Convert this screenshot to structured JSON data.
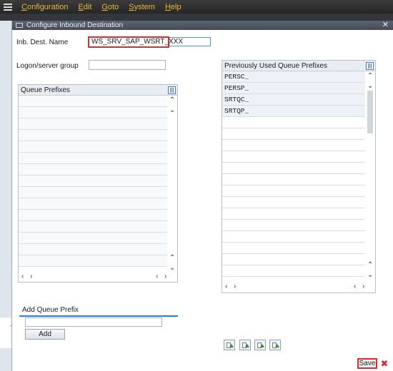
{
  "menubar": {
    "items": [
      {
        "underline": "C",
        "rest": "onfiguration"
      },
      {
        "underline": "E",
        "rest": "dit"
      },
      {
        "underline": "G",
        "rest": "oto"
      },
      {
        "underline": "S",
        "rest": "ystem"
      },
      {
        "underline": "H",
        "rest": "elp"
      }
    ]
  },
  "dialog": {
    "title": "Configure Inbound Destination",
    "close_glyph": "✕"
  },
  "form": {
    "inb_dest_label": "Inb. Dest. Name",
    "inb_dest_value": "WS_SRV_SAP_WSRT_XXX",
    "logon_label": "Logon/server group",
    "logon_value": ""
  },
  "queue_prefixes_table": {
    "header": "Queue Prefixes",
    "rows": []
  },
  "previous_prefixes_table": {
    "header": "Previously Used Queue Prefixes",
    "rows": [
      "PERSC_",
      "PERSP_",
      "SRTQC_",
      "SRTQP_"
    ]
  },
  "add_panel": {
    "title": "Add Queue Prefix",
    "input_value": "",
    "add_label": "Add"
  },
  "footer": {
    "save_label": "Save",
    "cancel_glyph": "✖"
  },
  "icons": {
    "scroll_up": "⌃",
    "scroll_down": "⌄",
    "scroll_left": "‹",
    "scroll_right": "›"
  }
}
